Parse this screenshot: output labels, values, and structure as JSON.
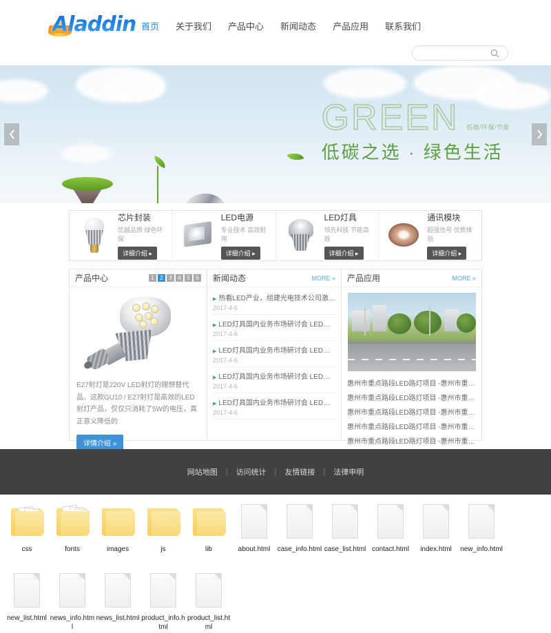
{
  "site": {
    "logo_text": "Aladdin",
    "nav": [
      {
        "label": "首页",
        "active": true
      },
      {
        "label": "关于我们",
        "active": false
      },
      {
        "label": "产品中心",
        "active": false
      },
      {
        "label": "新闻动态",
        "active": false
      },
      {
        "label": "产品应用",
        "active": false
      },
      {
        "label": "联系我们",
        "active": false
      }
    ],
    "search": {
      "value": "",
      "placeholder": "",
      "icon": "search-icon"
    }
  },
  "banner": {
    "headline": "GREEN",
    "headline_sub": "低碳/环保/节能",
    "subhead": "低碳之选 · 绿色生活",
    "prev_icon": "chevron-left-icon",
    "next_icon": "chevron-right-icon"
  },
  "categories": [
    {
      "title": "芯片封装",
      "desc": "优越品质 绿色环保",
      "button": "详细介绍 ▸",
      "icon": "led-bulb-icon"
    },
    {
      "title": "LED电源",
      "desc": "专业技术 高效耐用",
      "button": "详细介绍 ▸",
      "icon": "led-floodlight-icon"
    },
    {
      "title": "LED灯具",
      "desc": "领先科技 节能高效",
      "button": "详细介绍 ▸",
      "icon": "led-spotlight-icon"
    },
    {
      "title": "通讯模块",
      "desc": "超强信号 优质体验",
      "button": "详细介绍 ▸",
      "icon": "led-strip-icon"
    }
  ],
  "product_panel": {
    "title": "产品中心",
    "pager": [
      "1",
      "2",
      "3",
      "4",
      "5",
      "6"
    ],
    "pager_active": "2",
    "image_alt": "e27-led-spotlight-photo",
    "description": "E27射灯是220V LED射灯的理想替代品。这款GU10 / E27射灯是高效的LED射灯产品，仅仅只消耗了5W的电压，真正意义降低的",
    "button": "详情介绍 »"
  },
  "news_panel": {
    "title": "新闻动态",
    "more": "MORE »",
    "items": [
      {
        "title": "热看LED产业，组建光电技术公司激活...",
        "date": "2017-4-6"
      },
      {
        "title": "LED灯具国内业务市场研讨会 LED灯具...",
        "date": "2017-4-6"
      },
      {
        "title": "LED灯具国内业务市场研讨会 LED灯具...",
        "date": "2017-4-6"
      },
      {
        "title": "LED灯具国内业务市场研讨会 LED灯具...",
        "date": "2017-4-6"
      },
      {
        "title": "LED灯具国内业务市场研讨会 LED灯具...",
        "date": "2017-4-6"
      }
    ]
  },
  "app_panel": {
    "title": "产品应用",
    "more": "MORE »",
    "image_alt": "street-with-led-streetlights-photo",
    "items": [
      "惠州市重点路段LED路灯项目 -惠州市重点路...",
      "惠州市重点路段LED路灯项目 -惠州市重点路...",
      "惠州市重点路段LED路灯项目 -惠州市重点路...",
      "惠州市重点路段LED路灯项目 -惠州市重点路...",
      "惠州市重点路段LED路灯项目 -惠州市重点路..."
    ]
  },
  "footer": {
    "links": [
      "网站地图",
      "访问统计",
      "友情链接",
      "法律申明"
    ],
    "separator": "|"
  },
  "files": [
    {
      "name": "css",
      "type": "folder-docs"
    },
    {
      "name": "fonts",
      "type": "folder-docs"
    },
    {
      "name": "images",
      "type": "folder"
    },
    {
      "name": "js",
      "type": "folder"
    },
    {
      "name": "lib",
      "type": "folder"
    },
    {
      "name": "about.html",
      "type": "file"
    },
    {
      "name": "case_info.html",
      "type": "file"
    },
    {
      "name": "case_list.html",
      "type": "file"
    },
    {
      "name": "contact.html",
      "type": "file"
    },
    {
      "name": "index.html",
      "type": "file"
    },
    {
      "name": "new_info.html",
      "type": "file"
    },
    {
      "name": "new_list.html",
      "type": "file"
    },
    {
      "name": "news_info.html",
      "type": "file"
    },
    {
      "name": "news_list.html",
      "type": "file"
    },
    {
      "name": "product_info.html",
      "type": "file"
    },
    {
      "name": "product_list.html",
      "type": "file"
    }
  ],
  "colors": {
    "accent_blue": "#2f86d6",
    "green": "#5f9e45",
    "footer_bg": "#414141",
    "folder": "#f7d774"
  }
}
